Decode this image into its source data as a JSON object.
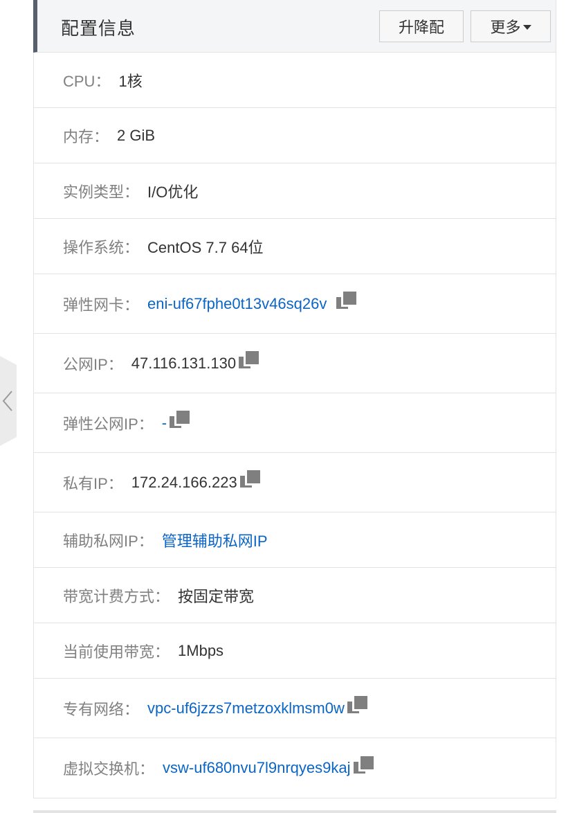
{
  "header": {
    "title": "配置信息",
    "upgrade_label": "升降配",
    "more_label": "更多"
  },
  "rows": [
    {
      "label": "CPU：",
      "value": "1核"
    },
    {
      "label": "内存：",
      "value": "2 GiB"
    },
    {
      "label": "实例类型：",
      "value": "I/O优化"
    },
    {
      "label": "操作系统：",
      "value": "CentOS 7.7 64位"
    },
    {
      "label": "弹性网卡：",
      "value": "eni-uf67fphe0t13v46sq26v"
    },
    {
      "label": "公网IP：",
      "value": "47.116.131.130"
    },
    {
      "label": "弹性公网IP：",
      "value": "-"
    },
    {
      "label": "私有IP：",
      "value": "172.24.166.223"
    },
    {
      "label": "辅助私网IP：",
      "value": "管理辅助私网IP"
    },
    {
      "label": "带宽计费方式：",
      "value": "按固定带宽"
    },
    {
      "label": "当前使用带宽：",
      "value": "1Mbps"
    },
    {
      "label": "专有网络：",
      "value": "vpc-uf6jzzs7metzoxklmsm0w"
    },
    {
      "label": "虚拟交换机：",
      "value": "vsw-uf680nvu7l9nrqyes9kaj"
    }
  ],
  "icons": {
    "copy": "copy-icon",
    "collapse": "chevron-left-icon",
    "dropdown": "caret-down-icon"
  },
  "colors": {
    "link": "#0b65c4",
    "label": "#808080",
    "value": "#333333",
    "header_bg": "#f4f5f7",
    "header_accent": "#58606b"
  }
}
